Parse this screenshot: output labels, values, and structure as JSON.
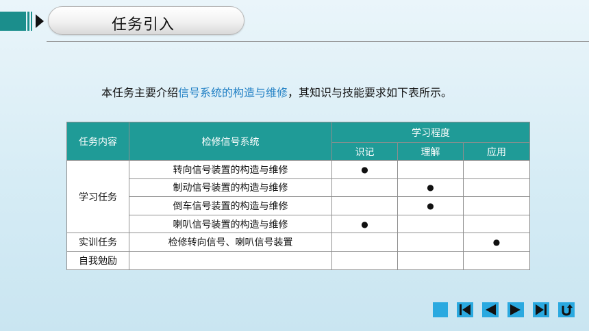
{
  "header": {
    "title": "任务引入"
  },
  "intro": {
    "prefix": "本任务主要介绍",
    "highlight": "信号系统的构造与维修",
    "suffix": "，其知识与技能要求如下表所示。"
  },
  "table": {
    "col_content": "任务内容",
    "col_task": "检修信号系统",
    "col_level": "学习程度",
    "sub_levels": [
      "识记",
      "理解",
      "应用"
    ],
    "marker": "●",
    "groups": [
      {
        "label": "学习任务",
        "rows": [
          {
            "item": "转向信号装置的构造与维修",
            "level": 0
          },
          {
            "item": "制动信号装置的构造与维修",
            "level": 1
          },
          {
            "item": "倒车信号装置的构造与维修",
            "level": 1
          },
          {
            "item": "喇叭信号装置的构造与维修",
            "level": 0
          }
        ]
      },
      {
        "label": "实训任务",
        "rows": [
          {
            "item": "检修转向信号、喇叭信号装置",
            "level": 2
          }
        ]
      },
      {
        "label": "自我勉励",
        "rows": [
          {
            "item": "",
            "level": -1
          }
        ]
      }
    ]
  },
  "colors": {
    "header_teal": "#1f9b97",
    "highlight_blue": "#1f7fc4",
    "nav_blue": "#2aa9e0"
  },
  "nav_icons": [
    "home-square-icon",
    "first-page-icon",
    "prev-page-icon",
    "next-page-icon",
    "last-page-icon",
    "return-icon"
  ]
}
